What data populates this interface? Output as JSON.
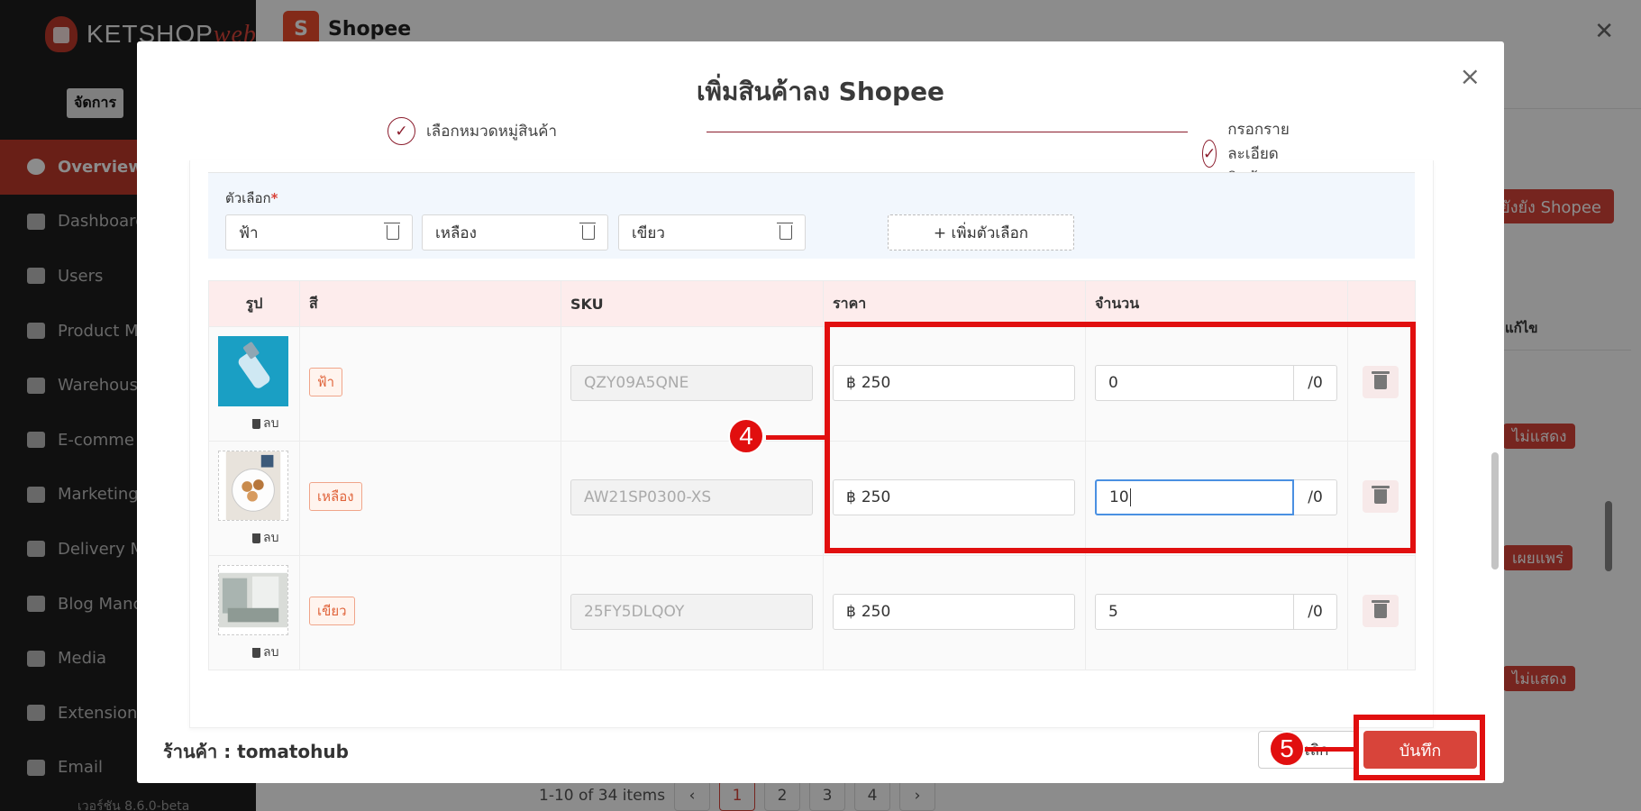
{
  "app": {
    "brand": "KETSHOP",
    "brand_suffix": "web",
    "manage_label": "จัดการ",
    "version": "เวอร์ชัน 8.6.0-beta",
    "menu": [
      {
        "label": "Overview",
        "active": true,
        "icon": "pie-chart-icon"
      },
      {
        "label": "Dashboard",
        "icon": "bar-chart-icon"
      },
      {
        "label": "Users",
        "icon": "users-icon"
      },
      {
        "label": "Product M",
        "icon": "tag-icon"
      },
      {
        "label": "Warehouse",
        "icon": "warehouse-icon"
      },
      {
        "label": "E-comme",
        "icon": "cart-icon"
      },
      {
        "label": "Marketing",
        "icon": "megaphone-icon"
      },
      {
        "label": "Delivery M",
        "icon": "truck-icon"
      },
      {
        "label": "Blog Manc",
        "icon": "blog-icon"
      },
      {
        "label": "Media",
        "icon": "folder-icon"
      },
      {
        "label": "Extension",
        "icon": "puzzle-icon"
      },
      {
        "label": "Email",
        "icon": "mail-icon"
      }
    ]
  },
  "panel": {
    "title": "Shopee",
    "send_button": "ยังยัง Shopee",
    "column_header": "แก้ไข",
    "badges": [
      "ไม่แสดง",
      "เผยแพร่",
      "ไม่แสดง"
    ],
    "pagination": {
      "summary": "1-10 of 34 items",
      "pages": [
        "1",
        "2",
        "3",
        "4"
      ],
      "current": "1",
      "prev": "‹",
      "next": "›"
    }
  },
  "modal": {
    "title": "เพิ่มสินค้าลง Shopee",
    "close": "×",
    "steps": [
      {
        "label": "เลือกหมวดหมู่สินค้า",
        "done": true
      },
      {
        "label": "กรอกรายละเอียดสินค้า",
        "done": true
      }
    ],
    "variant_label": "ตัวเลือก",
    "required_mark": "*",
    "options": [
      "ฟ้า",
      "เหลือง",
      "เขียว"
    ],
    "add_option": "+ เพิ่มตัวเลือก",
    "table": {
      "headers": [
        "รูป",
        "สี",
        "SKU",
        "ราคา",
        "จำนวน"
      ],
      "delete_image_label": "ลบ",
      "currency": "฿",
      "rows": [
        {
          "color": "ฟ้า",
          "sku": "QZY09A5QNE",
          "price": "250",
          "qty": "0",
          "stock": "/0",
          "image": "blue-bottle"
        },
        {
          "color": "เหลือง",
          "sku": "AW21SP0300-XS",
          "price": "250",
          "qty": "10",
          "stock": "/0",
          "image": "food-bowl"
        },
        {
          "color": "เขียว",
          "sku": "25FY5DLQOY",
          "price": "250",
          "qty": "5",
          "stock": "/0",
          "image": "room-photo"
        }
      ]
    },
    "store_label": "ร้านค้า : tomatohub",
    "cancel_button": "ยกเลิก",
    "save_button": "บันทึก"
  },
  "annotations": {
    "step4": "4",
    "step5": "5",
    "color": "#e10f0f"
  }
}
